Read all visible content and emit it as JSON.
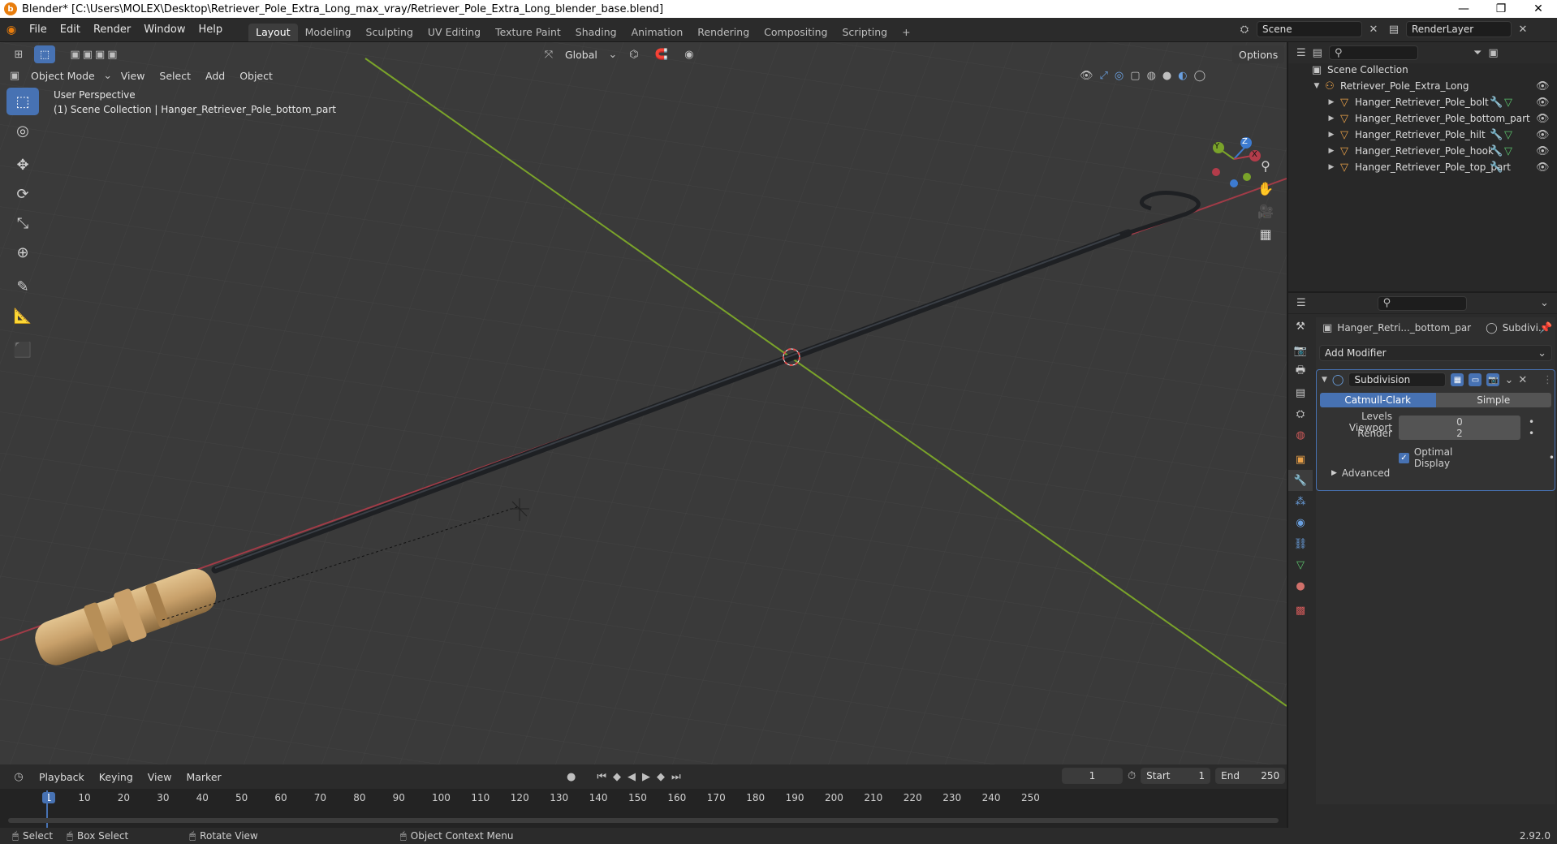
{
  "window": {
    "title": "Blender* [C:\\Users\\MOLEX\\Desktop\\Retriever_Pole_Extra_Long_max_vray/Retriever_Pole_Extra_Long_blender_base.blend]",
    "minimize": "—",
    "restore": "❐",
    "close": "✕"
  },
  "menus": [
    "File",
    "Edit",
    "Render",
    "Window",
    "Help"
  ],
  "workspaces": [
    "Layout",
    "Modeling",
    "Sculpting",
    "UV Editing",
    "Texture Paint",
    "Shading",
    "Animation",
    "Rendering",
    "Compositing",
    "Scripting"
  ],
  "active_workspace": "Layout",
  "add_workspace": "+",
  "scene": {
    "name": "Scene",
    "view_layer": "RenderLayer"
  },
  "viewport": {
    "mode": "Object Mode",
    "menu": [
      "View",
      "Select",
      "Add",
      "Object"
    ],
    "transform_orientation": "Global",
    "options": "Options",
    "overlay_title": "User Perspective",
    "overlay_context": "(1) Scene Collection | Hanger_Retriever_Pole_bottom_part",
    "gizmo_axes": {
      "x": "X",
      "y": "Y",
      "z": "Z"
    },
    "colors": {
      "x_axis": "#b33c4a",
      "y_axis": "#7aa32a",
      "z_axis": "#3d7bd0",
      "background": "#3a3a3a",
      "grid": "#454545"
    }
  },
  "outliner": {
    "root": "Scene Collection",
    "collection": "Retriever_Pole_Extra_Long",
    "objects": [
      {
        "name": "Hanger_Retriever_Pole_bolt",
        "modifier": true,
        "mesh": true
      },
      {
        "name": "Hanger_Retriever_Pole_bottom_part",
        "modifier": false,
        "mesh": false
      },
      {
        "name": "Hanger_Retriever_Pole_hilt",
        "modifier": true,
        "mesh": true
      },
      {
        "name": "Hanger_Retriever_Pole_hook",
        "modifier": true,
        "mesh": true
      },
      {
        "name": "Hanger_Retriever_Pole_top_part",
        "modifier": true,
        "mesh": false
      }
    ]
  },
  "properties": {
    "object_name": "Hanger_Retri..._bottom_par",
    "modifier_short": "Subdivi...",
    "add_modifier": "Add Modifier",
    "modifier": {
      "name": "Subdivision",
      "types": [
        "Catmull-Clark",
        "Simple"
      ],
      "active_type": "Catmull-Clark",
      "levels_viewport_label": "Levels Viewport",
      "levels_viewport": "0",
      "render_label": "Render",
      "render": "2",
      "optimal_display_label": "Optimal Display",
      "optimal_display": true,
      "advanced": "Advanced"
    }
  },
  "timeline": {
    "menu": [
      "Playback",
      "Keying",
      "View",
      "Marker"
    ],
    "current_frame": "1",
    "start_label": "Start",
    "start": "1",
    "end_label": "End",
    "end": "250",
    "ticks": [
      "1",
      "10",
      "20",
      "30",
      "40",
      "50",
      "60",
      "70",
      "80",
      "90",
      "100",
      "110",
      "120",
      "130",
      "140",
      "150",
      "160",
      "170",
      "180",
      "190",
      "200",
      "210",
      "220",
      "230",
      "240",
      "250"
    ]
  },
  "statusbar": {
    "select": "Select",
    "box_select": "Box Select",
    "rotate_view": "Rotate View",
    "context_menu": "Object Context Menu",
    "version": "2.92.0"
  }
}
